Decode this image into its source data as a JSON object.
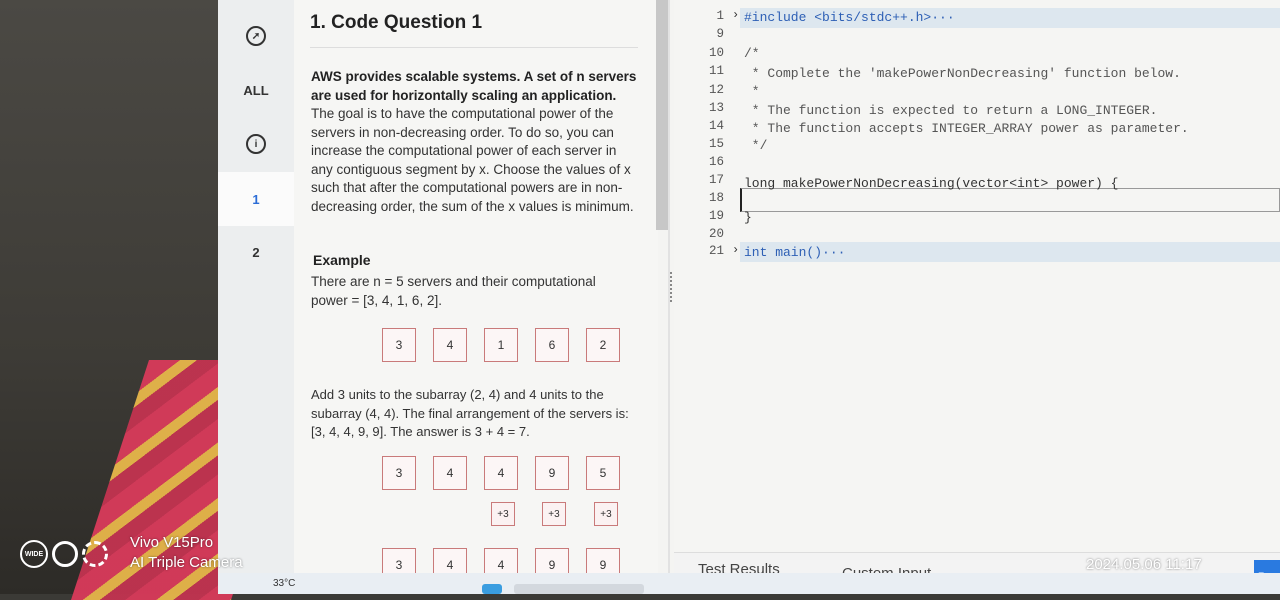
{
  "sidebar": {
    "all_label": "ALL",
    "q1_label": "1",
    "q2_label": "2"
  },
  "problem": {
    "title": "1. Code Question 1",
    "para1_bold": "AWS provides scalable systems. A set of n servers are used for horizontally scaling an application.",
    "para1_rest": " The goal is to have the computational power of the servers in non-decreasing order.  To do so, you can increase the computational power of each server in any contiguous segment by x. Choose the values of x such that after the computational powers are in non-decreasing order, the sum of the x values is minimum.",
    "example_title": "Example",
    "example_text": "There are n = 5 servers and their computational power = [3, 4, 1, 6, 2].",
    "initial_cells": [
      "3",
      "4",
      "1",
      "6",
      "2"
    ],
    "explain": "Add 3 units to the subarray (2, 4) and 4 units to the subarray (4, 4). The final arrangement of the servers is: [3, 4, 4, 9, 9].    The answer is 3 + 4 = 7.",
    "mid_cells": [
      "3",
      "4",
      "4",
      "9",
      "5"
    ],
    "plus_labels": [
      "+3",
      "+3",
      "+3"
    ],
    "final_cells": [
      "3",
      "4",
      "4",
      "9",
      "9"
    ]
  },
  "editor": {
    "lines": [
      {
        "n": "1",
        "text": "#include <bits/stdc++.h>···"
      },
      {
        "n": "9",
        "text": ""
      },
      {
        "n": "10",
        "text": "/*"
      },
      {
        "n": "11",
        "text": " * Complete the 'makePowerNonDecreasing' function below."
      },
      {
        "n": "12",
        "text": " *"
      },
      {
        "n": "13",
        "text": " * The function is expected to return a LONG_INTEGER."
      },
      {
        "n": "14",
        "text": " * The function accepts INTEGER_ARRAY power as parameter."
      },
      {
        "n": "15",
        "text": " */"
      },
      {
        "n": "16",
        "text": ""
      },
      {
        "n": "17",
        "text": "long makePowerNonDecreasing(vector<int> power) {"
      },
      {
        "n": "18",
        "text": ""
      },
      {
        "n": "19",
        "text": "}"
      },
      {
        "n": "20",
        "text": ""
      },
      {
        "n": "21",
        "text": "int main()···"
      }
    ]
  },
  "bottom": {
    "test_results": "Test Results",
    "custom_input": "Custom Input",
    "run": "Run"
  },
  "taskbar": {
    "weather": "33°C"
  },
  "watermark": {
    "model": "Vivo V15Pro",
    "camera": "AI Triple Camera",
    "timestamp": "2024.05.06 11:17",
    "wide": "WIDE"
  },
  "colors": {
    "accent": "#2b6cd6",
    "cell_border": "#c97a7a",
    "run_button": "#2a7ae0"
  }
}
